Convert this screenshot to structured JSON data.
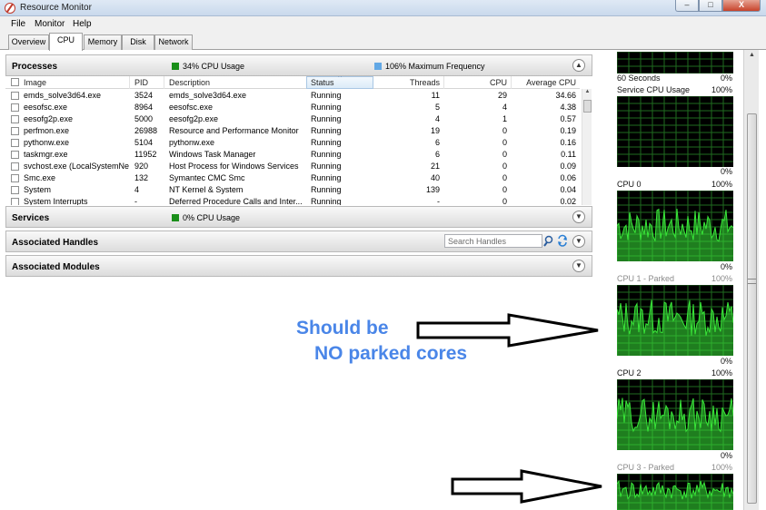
{
  "window": {
    "title": "Resource Monitor",
    "minimize": "–",
    "restore": "□",
    "close": "X"
  },
  "menu": [
    "File",
    "Monitor",
    "Help"
  ],
  "tabs": [
    {
      "label": "Overview",
      "active": false
    },
    {
      "label": "CPU",
      "active": true
    },
    {
      "label": "Memory",
      "active": false
    },
    {
      "label": "Disk",
      "active": false
    },
    {
      "label": "Network",
      "active": false
    }
  ],
  "processes": {
    "title": "Processes",
    "cpu_usage": "34% CPU Usage",
    "max_freq": "106% Maximum Frequency",
    "cpu_color": "#1a8f1a",
    "freq_color": "#62a8e5",
    "columns": [
      "Image",
      "PID",
      "Description",
      "Status",
      "Threads",
      "CPU",
      "Average CPU"
    ],
    "rows": [
      [
        "emds_solve3d64.exe",
        "3524",
        "emds_solve3d64.exe",
        "Running",
        "11",
        "29",
        "34.66"
      ],
      [
        "eesofsc.exe",
        "8964",
        "eesofsc.exe",
        "Running",
        "5",
        "4",
        "4.38"
      ],
      [
        "eesofg2p.exe",
        "5000",
        "eesofg2p.exe",
        "Running",
        "4",
        "1",
        "0.57"
      ],
      [
        "perfmon.exe",
        "26988",
        "Resource and Performance Monitor",
        "Running",
        "19",
        "0",
        "0.19"
      ],
      [
        "pythonw.exe",
        "5104",
        "pythonw.exe",
        "Running",
        "6",
        "0",
        "0.16"
      ],
      [
        "taskmgr.exe",
        "11952",
        "Windows Task Manager",
        "Running",
        "6",
        "0",
        "0.11"
      ],
      [
        "svchost.exe (LocalSystemNet...",
        "920",
        "Host Process for Windows Services",
        "Running",
        "21",
        "0",
        "0.09"
      ],
      [
        "Smc.exe",
        "132",
        "Symantec CMC Smc",
        "Running",
        "40",
        "0",
        "0.06"
      ],
      [
        "System",
        "4",
        "NT Kernel & System",
        "Running",
        "139",
        "0",
        "0.04"
      ],
      [
        "System Interrupts",
        "-",
        "Deferred Procedure Calls and Inter...",
        "Running",
        "-",
        "0",
        "0.02"
      ]
    ]
  },
  "services": {
    "title": "Services",
    "cpu_usage": "0% CPU Usage"
  },
  "handles": {
    "title": "Associated Handles",
    "search_placeholder": "Search Handles"
  },
  "modules": {
    "title": "Associated Modules"
  },
  "graphs": {
    "top_time": "60 Seconds",
    "top_pct": "0%",
    "service": {
      "label": "Service CPU Usage",
      "max": "100%",
      "min": "0%"
    },
    "cpus": [
      {
        "label": "CPU 0",
        "max": "100%",
        "min": "0%",
        "parked": false
      },
      {
        "label": "CPU 1 - Parked",
        "max": "100%",
        "min": "0%",
        "parked": true
      },
      {
        "label": "CPU 2",
        "max": "100%",
        "min": "0%",
        "parked": false
      },
      {
        "label": "CPU 3 - Parked",
        "max": "100%",
        "min": "",
        "parked": true
      }
    ],
    "grid_color": "#1f6b1f",
    "line_color": "#39e639"
  },
  "annotation": {
    "line1": "Should be",
    "line2": "NO parked cores",
    "color": "#4a86e8"
  }
}
